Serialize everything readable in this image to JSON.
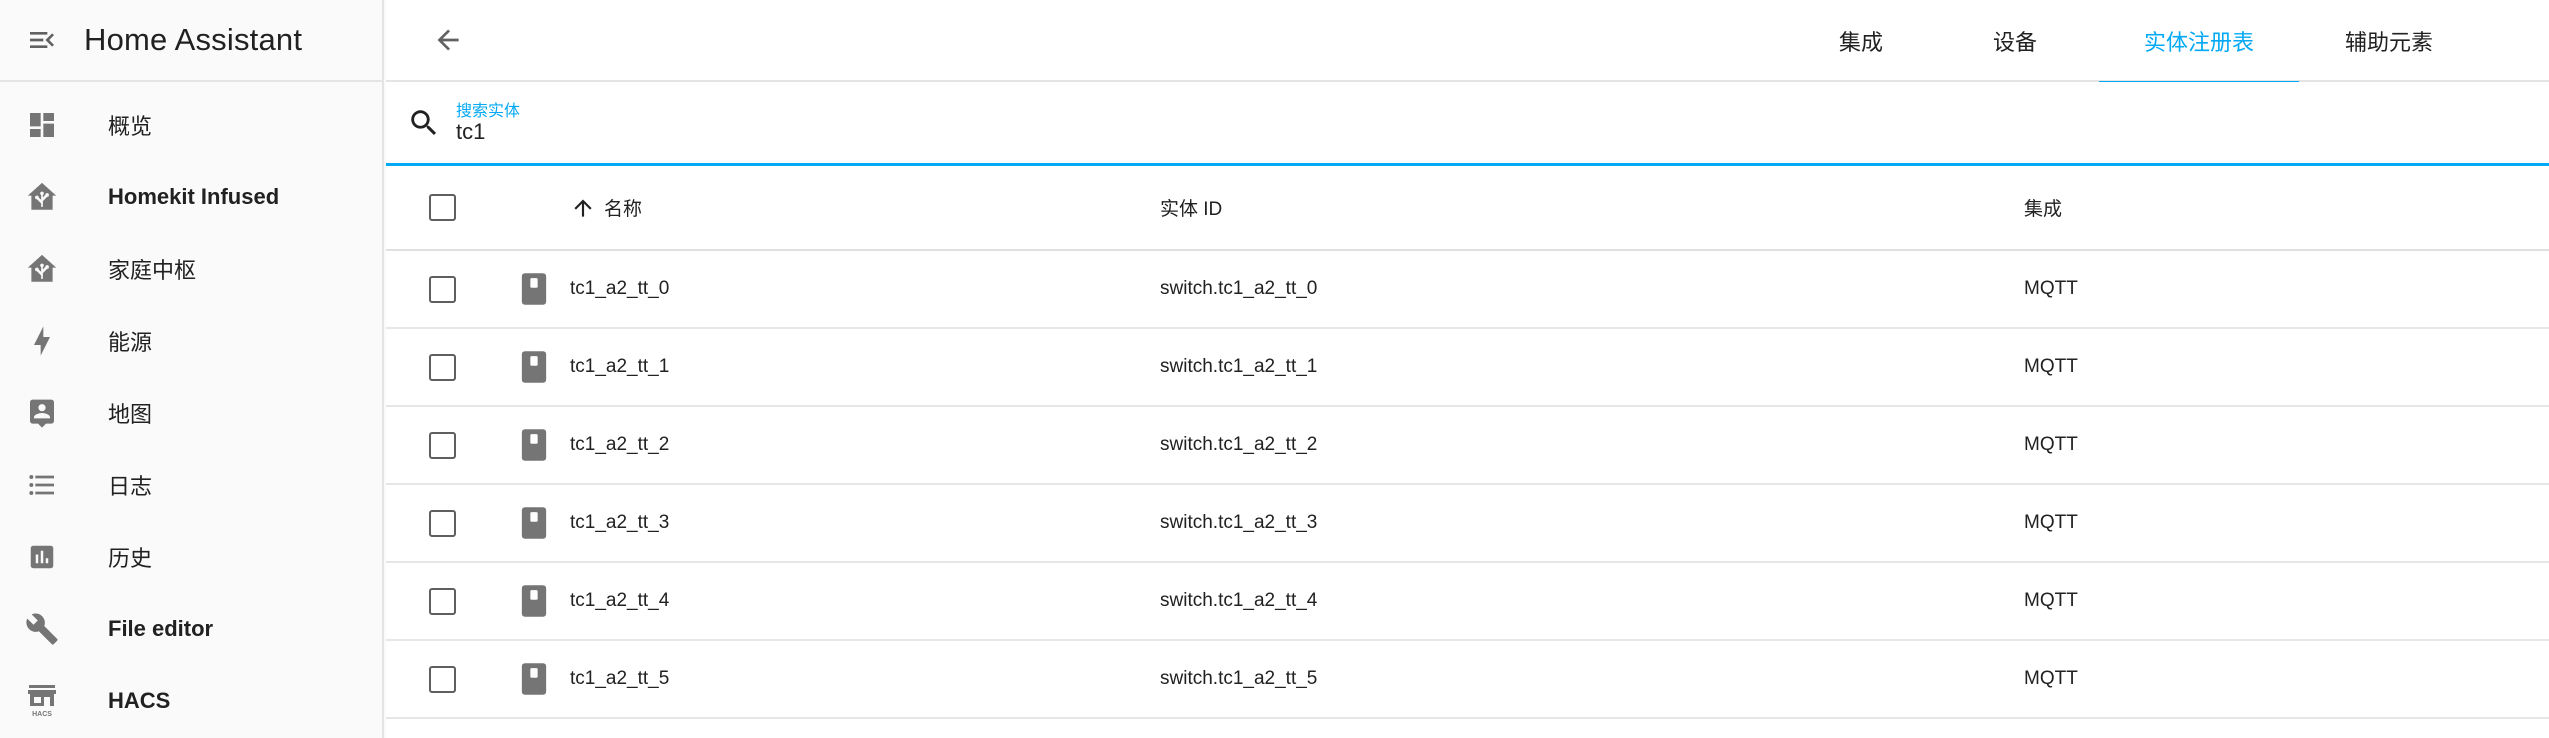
{
  "app": {
    "title": "Home Assistant"
  },
  "sidebar": {
    "items": [
      {
        "label": "概览",
        "icon": "view-dashboard-icon"
      },
      {
        "label": "Homekit Infused",
        "icon": "home-assistant-icon"
      },
      {
        "label": "家庭中枢",
        "icon": "home-assistant-icon"
      },
      {
        "label": "能源",
        "icon": "lightning-bolt-icon"
      },
      {
        "label": "地图",
        "icon": "account-box-icon"
      },
      {
        "label": "日志",
        "icon": "format-list-bulleted-icon"
      },
      {
        "label": "历史",
        "icon": "chart-box-icon"
      },
      {
        "label": "File editor",
        "icon": "wrench-icon"
      },
      {
        "label": "HACS",
        "icon": "hacs-icon",
        "icon_text": "HACS"
      }
    ]
  },
  "tabs": [
    {
      "label": "集成",
      "active": false
    },
    {
      "label": "设备",
      "active": false
    },
    {
      "label": "实体注册表",
      "active": true
    },
    {
      "label": "辅助元素",
      "active": false
    }
  ],
  "search": {
    "label": "搜索实体",
    "value": "tc1"
  },
  "table": {
    "columns": {
      "name": "名称",
      "entity_id": "实体 ID",
      "integration": "集成"
    },
    "rows": [
      {
        "name": "tc1_a2_tt_0",
        "entity_id": "switch.tc1_a2_tt_0",
        "integration": "MQTT"
      },
      {
        "name": "tc1_a2_tt_1",
        "entity_id": "switch.tc1_a2_tt_1",
        "integration": "MQTT"
      },
      {
        "name": "tc1_a2_tt_2",
        "entity_id": "switch.tc1_a2_tt_2",
        "integration": "MQTT"
      },
      {
        "name": "tc1_a2_tt_3",
        "entity_id": "switch.tc1_a2_tt_3",
        "integration": "MQTT"
      },
      {
        "name": "tc1_a2_tt_4",
        "entity_id": "switch.tc1_a2_tt_4",
        "integration": "MQTT"
      },
      {
        "name": "tc1_a2_tt_5",
        "entity_id": "switch.tc1_a2_tt_5",
        "integration": "MQTT"
      }
    ]
  },
  "colors": {
    "accent": "#03a9f4",
    "icon_gray": "#757575",
    "text": "#212121"
  }
}
